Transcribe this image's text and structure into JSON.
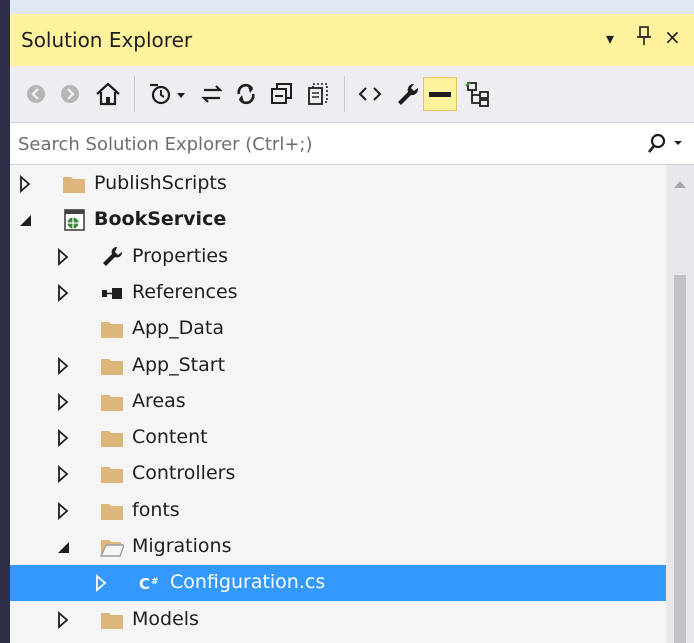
{
  "panel": {
    "title": "Solution Explorer",
    "controls": {
      "dropdown": "▾",
      "pin": "ᛘ",
      "close": "×"
    }
  },
  "toolbar": {
    "buttons": [
      {
        "name": "back-icon"
      },
      {
        "name": "forward-icon"
      },
      {
        "name": "home-icon"
      },
      {
        "name": "pending-changes-filter-icon"
      },
      {
        "name": "dropdown-arrow-icon"
      },
      {
        "name": "sync-with-active-document-icon"
      },
      {
        "name": "refresh-icon"
      },
      {
        "name": "collapse-all-icon"
      },
      {
        "name": "show-all-files-icon"
      },
      {
        "name": "view-code-icon"
      },
      {
        "name": "properties-wrench-icon"
      },
      {
        "name": "preview-selected-items-icon"
      },
      {
        "name": "class-diagram-icon"
      }
    ]
  },
  "search": {
    "placeholder": "Search Solution Explorer (Ctrl+;)",
    "value": ""
  },
  "tree": {
    "items": [
      {
        "label": "PublishScripts",
        "expander": "collapsed",
        "icon": "folder-icon",
        "level": 0,
        "bold": false,
        "selected": false
      },
      {
        "label": "BookService",
        "expander": "expanded",
        "icon": "web-project-icon",
        "level": 0,
        "bold": true,
        "selected": false
      },
      {
        "label": "Properties",
        "expander": "collapsed",
        "icon": "wrench-icon",
        "level": 1,
        "bold": false,
        "selected": false
      },
      {
        "label": "References",
        "expander": "collapsed",
        "icon": "references-icon",
        "level": 1,
        "bold": false,
        "selected": false
      },
      {
        "label": "App_Data",
        "expander": "none",
        "icon": "folder-icon",
        "level": 1,
        "bold": false,
        "selected": false
      },
      {
        "label": "App_Start",
        "expander": "collapsed",
        "icon": "folder-icon",
        "level": 1,
        "bold": false,
        "selected": false
      },
      {
        "label": "Areas",
        "expander": "collapsed",
        "icon": "folder-icon",
        "level": 1,
        "bold": false,
        "selected": false
      },
      {
        "label": "Content",
        "expander": "collapsed",
        "icon": "folder-icon",
        "level": 1,
        "bold": false,
        "selected": false
      },
      {
        "label": "Controllers",
        "expander": "collapsed",
        "icon": "folder-icon",
        "level": 1,
        "bold": false,
        "selected": false
      },
      {
        "label": "fonts",
        "expander": "collapsed",
        "icon": "folder-icon",
        "level": 1,
        "bold": false,
        "selected": false
      },
      {
        "label": "Migrations",
        "expander": "expanded",
        "icon": "folder-open-icon",
        "level": 1,
        "bold": false,
        "selected": false
      },
      {
        "label": "Configuration.cs",
        "expander": "collapsed",
        "icon": "csharp-file-icon",
        "level": 2,
        "bold": false,
        "selected": true
      },
      {
        "label": "Models",
        "expander": "collapsed",
        "icon": "folder-icon",
        "level": 1,
        "bold": false,
        "selected": false
      }
    ]
  },
  "colors": {
    "title_bar": "#fff29d",
    "selection": "#3399ff",
    "folder": "#dcb67a",
    "toolbar_active": "#fff29d"
  }
}
